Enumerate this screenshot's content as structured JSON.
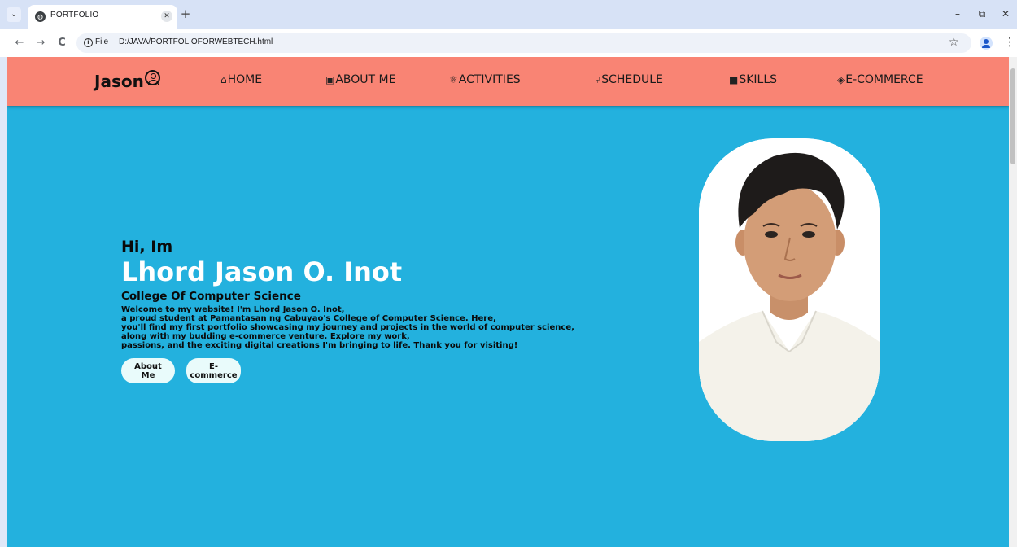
{
  "browser": {
    "tab_title": "PORTFOLIO",
    "tab_close": "✕",
    "new_tab": "+",
    "omnibox_chip": "File",
    "url": "D:/JAVA/PORTFOLIOFORWEBTECH.html",
    "back": "←",
    "forward": "→",
    "reload": "C",
    "bookmark": "☆",
    "menu": "⋮",
    "minimize": "–",
    "restore": "⧉",
    "close": "✕"
  },
  "navbar": {
    "brand": "Jason",
    "links": [
      {
        "icon": "⌂",
        "label": "HOME"
      },
      {
        "icon": "▣",
        "label": "ABOUT ME"
      },
      {
        "icon": "⚛",
        "label": "ACTIVITIES"
      },
      {
        "icon": "⑂",
        "label": "SCHEDULE"
      },
      {
        "icon": "■",
        "label": "SKILLS"
      },
      {
        "icon": "◈",
        "label": "E-COMMERCE"
      }
    ]
  },
  "hero": {
    "greeting": "Hi, Im",
    "name": "Lhord Jason O. Inot",
    "college": "College Of Computer Science",
    "intro": "Welcome to my website! I'm Lhord Jason O. Inot,\na proud student at Pamantasan ng Cabuyao's College of Computer Science. Here,\nyou'll find my first portfolio showcasing my journey and projects in the world of computer science,\nalong with my budding e-commerce venture. Explore my work,\npassions, and the exciting digital creations I'm bringing to life. Thank you for visiting!",
    "buttons": {
      "about": "About Me",
      "ecommerce": "E-commerce"
    }
  },
  "colors": {
    "navbar": "#f98474",
    "page_background": "#23b1de",
    "button": "#e9fbfb"
  }
}
